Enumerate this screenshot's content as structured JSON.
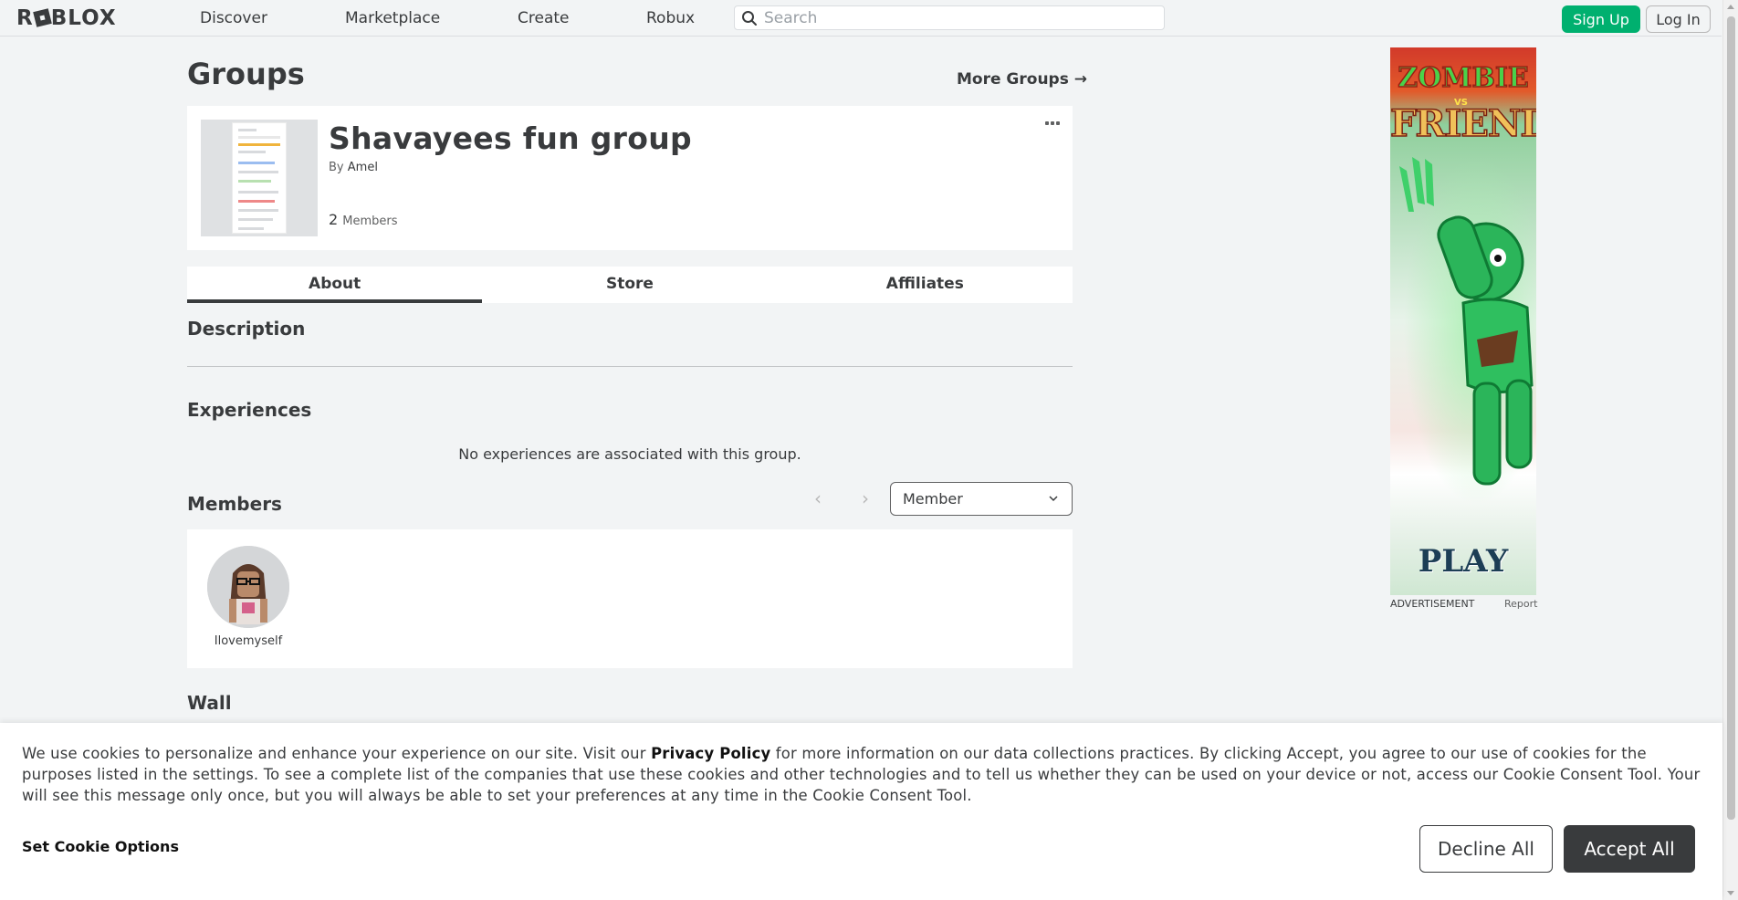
{
  "header": {
    "logo_text": "ROBLOX",
    "nav": [
      "Discover",
      "Marketplace",
      "Create",
      "Robux"
    ],
    "search_placeholder": "Search",
    "signup_label": "Sign Up",
    "login_label": "Log In"
  },
  "page": {
    "title": "Groups",
    "more_groups": "More Groups →"
  },
  "group": {
    "name": "Shavayees fun group",
    "by_prefix": "By",
    "owner": "Amel",
    "member_count": "2",
    "member_label": "Members"
  },
  "tabs": [
    "About",
    "Store",
    "Affiliates"
  ],
  "sections": {
    "description": "Description",
    "experiences": "Experiences",
    "experiences_empty": "No experiences are associated with this group.",
    "members": "Members",
    "role_select_value": "Member",
    "wall": "Wall"
  },
  "members": [
    {
      "username": "Ilovemyself"
    }
  ],
  "ad": {
    "headline_top": "ZOMBIE",
    "headline_vs": "VS",
    "headline_bottom": "FRIEND",
    "cta": "PLAY",
    "label": "ADVERTISEMENT",
    "report": "Report"
  },
  "cookie": {
    "text_before": "We use cookies to personalize and enhance your experience on our site. Visit our ",
    "policy_link": "Privacy Policy",
    "text_after": " for more information on our data collections practices. By clicking Accept, you agree to our use of cookies for the purposes listed in the settings. To see a complete list of the companies that use these cookies and other technologies and to tell us whether they can be used on your device or not, access our Cookie Consent Tool. Your will see this message only once, but you will always be able to set your preferences at any time in the Cookie Consent Tool.",
    "options_label": "Set Cookie Options",
    "decline_label": "Decline All",
    "accept_label": "Accept All"
  },
  "colors": {
    "accent_green": "#00b06f",
    "text_dark": "#393b3d",
    "background": "#f2f4f5"
  }
}
